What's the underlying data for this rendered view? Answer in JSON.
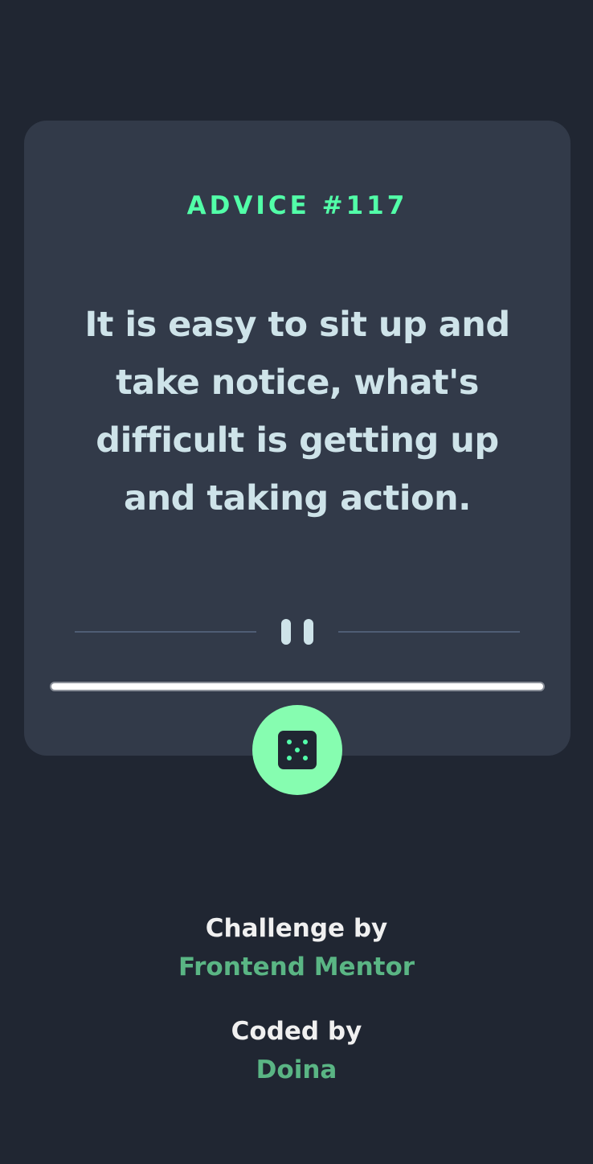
{
  "advice": {
    "heading": "ADVICE #117",
    "quote": "It is easy to sit up and take notice, what's difficult is getting up and taking action."
  },
  "audio": {
    "state": "playing",
    "progress": 1.0
  },
  "controls": {
    "dice_icon": "dice-five-icon",
    "pause_icon": "pause-icon"
  },
  "footer": {
    "challenge_label": "Challenge by",
    "challenge_link": "Frontend Mentor",
    "coded_label": "Coded by",
    "coded_link": "Doina"
  },
  "colors": {
    "background": "#202632",
    "card": "#323a49",
    "accent": "#53ffaa",
    "text": "#cee3e9",
    "link": "#5ab584"
  }
}
